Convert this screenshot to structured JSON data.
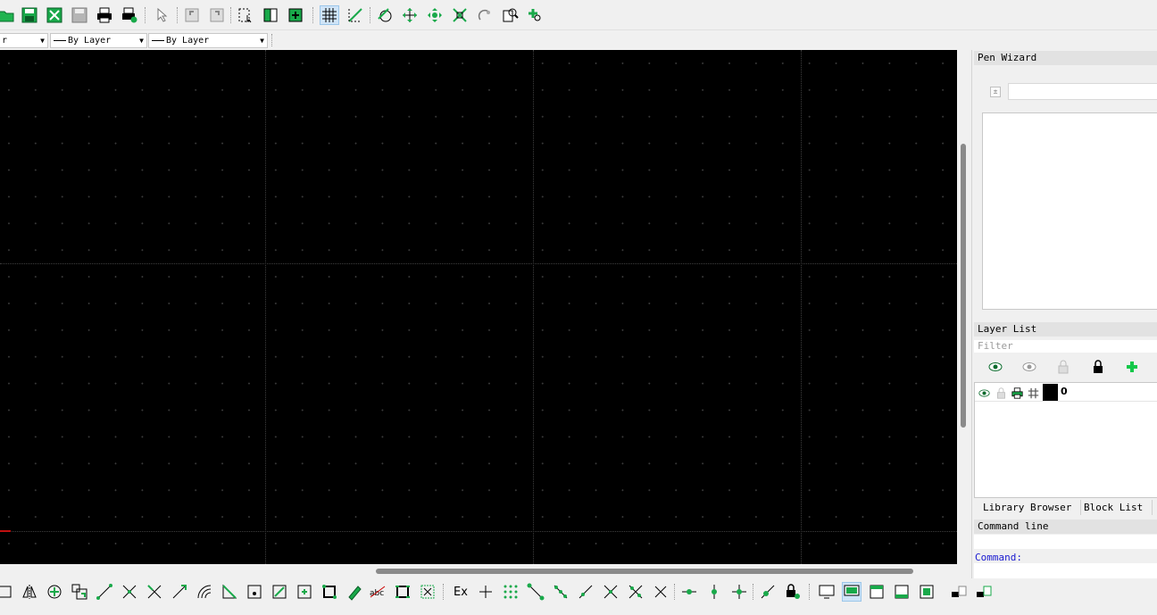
{
  "toolbar_file": {
    "buttons": [
      {
        "name": "open-icon"
      },
      {
        "name": "save-icon"
      },
      {
        "name": "save-as-icon"
      },
      {
        "name": "save-all-icon"
      },
      {
        "name": "print-icon"
      },
      {
        "name": "print-preview-icon"
      }
    ]
  },
  "toolbar_main": {
    "buttons": [
      {
        "name": "select-pointer-icon"
      },
      {
        "name": "undo-icon"
      },
      {
        "name": "redo-icon"
      },
      {
        "name": "block-select-icon"
      },
      {
        "name": "block-icon"
      },
      {
        "name": "add-block-icon"
      },
      {
        "name": "grid-icon",
        "active": true
      },
      {
        "name": "draft-mode-icon"
      },
      {
        "name": "redraw-icon"
      },
      {
        "name": "zoom-pan-icon"
      },
      {
        "name": "zoom-in-icon"
      },
      {
        "name": "zoom-auto-icon"
      },
      {
        "name": "zoom-previous-icon"
      },
      {
        "name": "zoom-window-icon"
      },
      {
        "name": "zoom-pan-move-icon"
      }
    ]
  },
  "pen_toolbar": {
    "layer_combo": "r",
    "linetype_combo": "By Layer",
    "width_combo": "By Layer"
  },
  "dock": {
    "pen_wizard_title": "Pen Wizard",
    "layer_list_title": "Layer List",
    "filter_placeholder": "Filter",
    "layers": [
      {
        "name": "0",
        "visible": true,
        "locked": false,
        "printable": true,
        "color": "#000000"
      }
    ],
    "tabs": [
      "Library Browser",
      "Block List"
    ],
    "command_line_title": "Command line",
    "command_label": "Command:"
  },
  "bottom_toolbar": {
    "ex_label": "Ex"
  },
  "colors": {
    "accent_green": "#14b04a",
    "canvas_bg": "#000000",
    "command_blue": "#1a1ad0"
  }
}
